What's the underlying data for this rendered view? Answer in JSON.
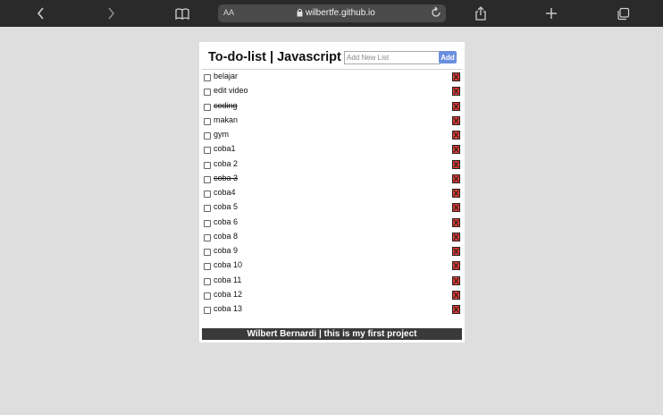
{
  "browser": {
    "address_text_size_label": "AA",
    "url": "wilbertfe.github.io",
    "icons": [
      "back-icon",
      "forward-icon",
      "bookmarks-icon",
      "lock-icon",
      "reload-icon",
      "share-icon",
      "new-tab-icon",
      "tabs-icon"
    ]
  },
  "app": {
    "title": "To-do-list | Javascript",
    "new_item_placeholder": "Add New List",
    "add_label": "Add",
    "items": [
      {
        "label": "belajar",
        "done": false
      },
      {
        "label": "edit video",
        "done": false
      },
      {
        "label": "coding",
        "done": true
      },
      {
        "label": "makan",
        "done": false
      },
      {
        "label": "gym",
        "done": false
      },
      {
        "label": "coba1",
        "done": false
      },
      {
        "label": "coba 2",
        "done": false
      },
      {
        "label": "coba 3",
        "done": true
      },
      {
        "label": "coba4",
        "done": false
      },
      {
        "label": "coba 5",
        "done": false
      },
      {
        "label": "coba 6",
        "done": false
      },
      {
        "label": "coba 8",
        "done": false
      },
      {
        "label": "coba 9",
        "done": false
      },
      {
        "label": "coba 10",
        "done": false
      },
      {
        "label": "coba 11",
        "done": false
      },
      {
        "label": "coba 12",
        "done": false
      },
      {
        "label": "coba 13",
        "done": false
      }
    ],
    "footer": "Wilbert Bernardi | this is my first project"
  },
  "colors": {
    "page_bg": "#dedede",
    "browser_bar": "#2a2a2a",
    "add_button": "#6b8fdf",
    "delete_button": "#e53935",
    "footer_bg": "#3a3a3a"
  }
}
